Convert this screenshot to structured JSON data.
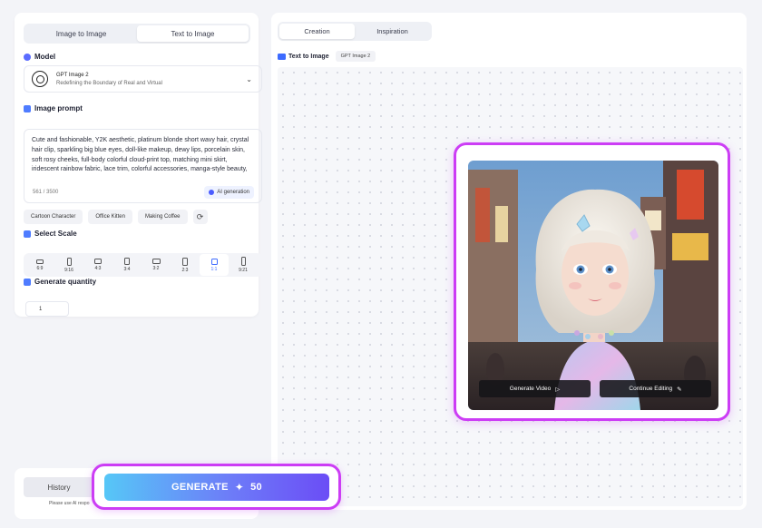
{
  "mode_tabs": [
    {
      "label": "Image to Image",
      "active": false
    },
    {
      "label": "Text to Image",
      "active": true
    }
  ],
  "model": {
    "section_label": "Model",
    "name": "GPT Image 2",
    "description": "Redefining the Boundary of Real and Virtual"
  },
  "prompt": {
    "section_label": "Image prompt",
    "text": "Cute and fashionable, Y2K aesthetic, platinum blonde short wavy hair, crystal hair clip, sparkling big blue eyes, doll-like makeup, dewy lips, porcelain skin, soft rosy cheeks, full-body colorful cloud-print top, matching mini skirt, iridescent rainbow fabric, lace trim, colorful accessories, manga-style beauty, dreamy",
    "count": "561 / 3500",
    "ai_button": "AI generation"
  },
  "chips": [
    "Cartoon Character",
    "Office Kitten",
    "Making Coffee"
  ],
  "scale": {
    "section_label": "Select Scale",
    "options": [
      {
        "label": "6:9",
        "active": false
      },
      {
        "label": "9:16",
        "active": false
      },
      {
        "label": "4:3",
        "active": false
      },
      {
        "label": "3:4",
        "active": false
      },
      {
        "label": "3:2",
        "active": false
      },
      {
        "label": "2:3",
        "active": false
      },
      {
        "label": "1:1",
        "active": true
      },
      {
        "label": "9:21",
        "active": false
      }
    ]
  },
  "quantity": {
    "section_label": "Generate quantity",
    "value": "1"
  },
  "history": {
    "label": "History",
    "disclaimer": "Please use AI respo"
  },
  "generate": {
    "label": "GENERATE",
    "cost": "50"
  },
  "view_tabs": [
    {
      "label": "Creation",
      "active": true
    },
    {
      "label": "Inspiration",
      "active": false
    }
  ],
  "result": {
    "mode_label": "Text to Image",
    "model_tag": "GPT Image 2",
    "generate_video": "Generate Video",
    "continue_editing": "Continue Editing"
  },
  "colors": {
    "accent": "#3d6bff",
    "highlight_border": "#cc3df5",
    "generate_gradient_start": "#56c7f7",
    "generate_gradient_end": "#6b4df6"
  }
}
